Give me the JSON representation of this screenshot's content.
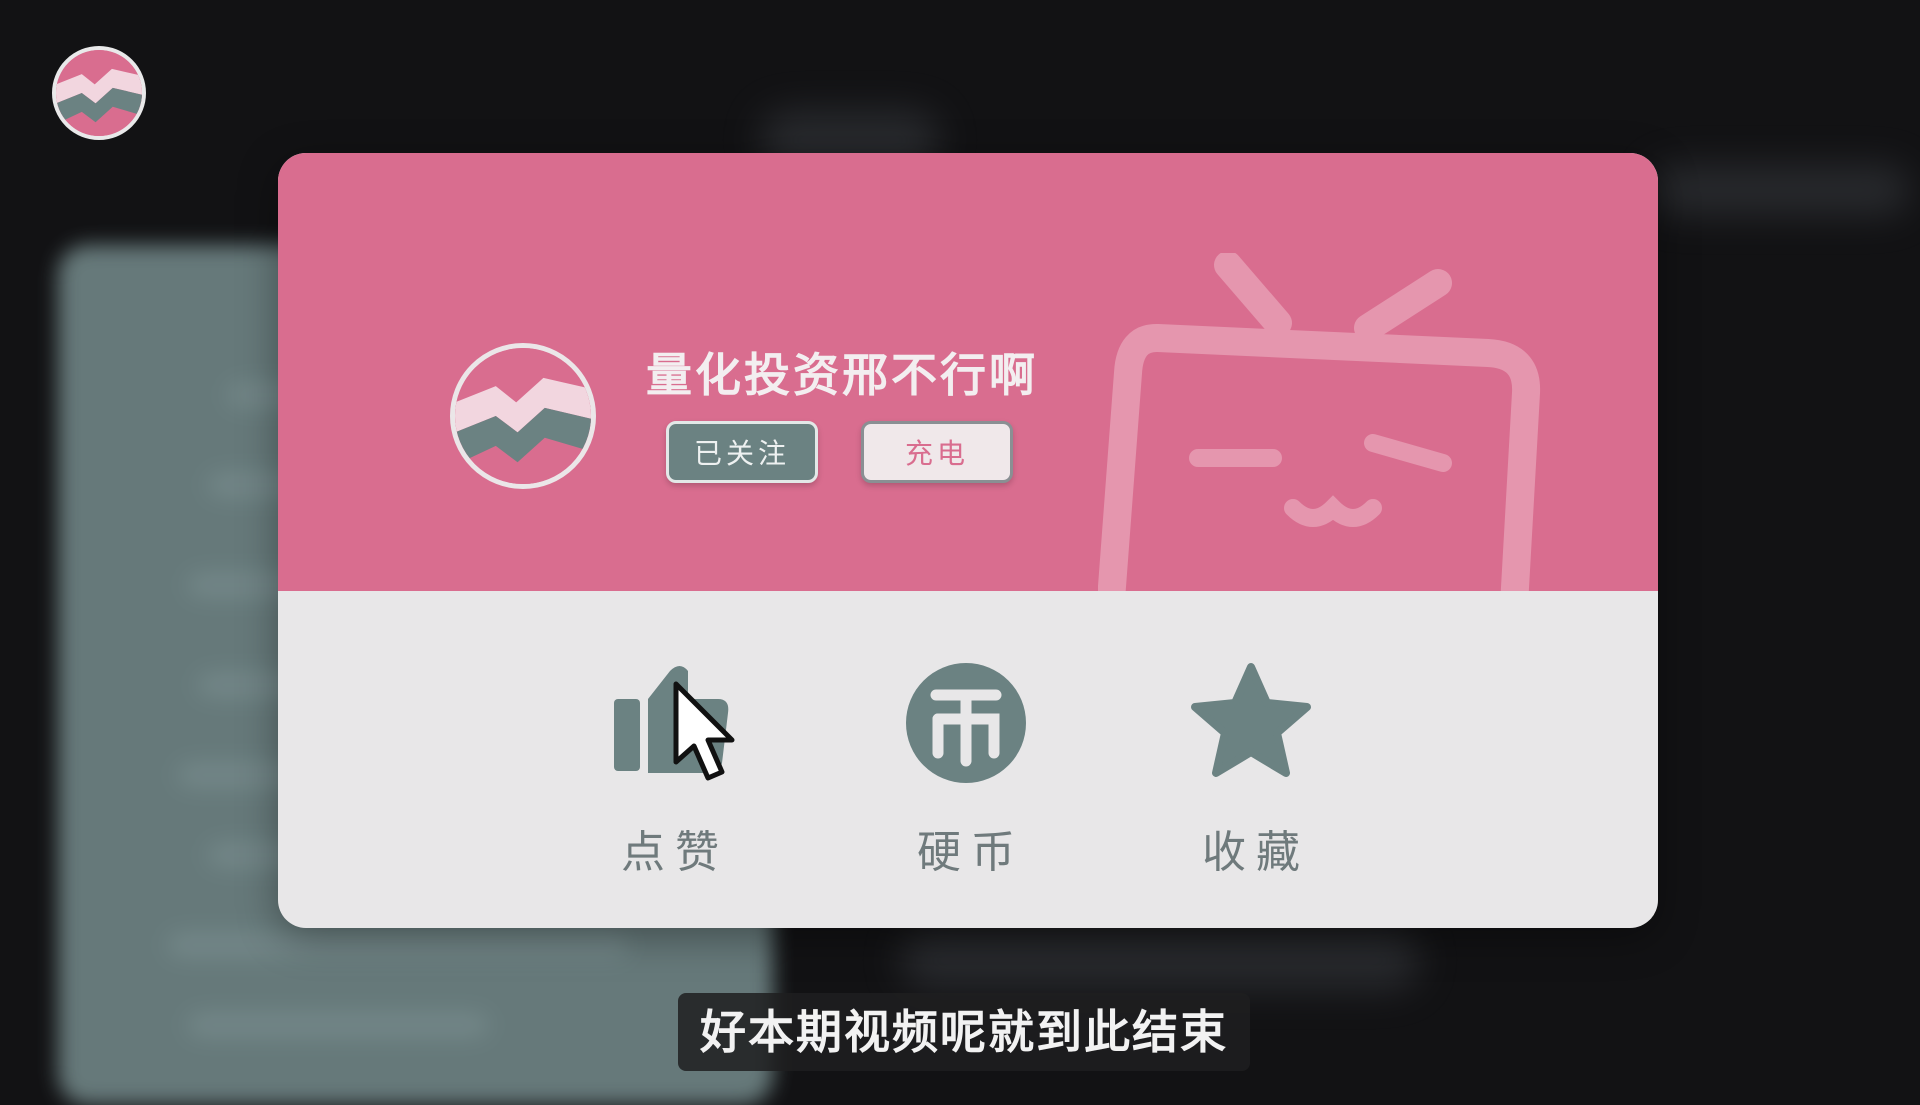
{
  "uploader": {
    "name": "量化投资邢不行啊",
    "follow_label": "已关注",
    "charge_label": "充电"
  },
  "actions": [
    {
      "label": "点赞",
      "icon": "thumbs-up-icon"
    },
    {
      "label": "硬币",
      "icon": "coin-icon"
    },
    {
      "label": "收藏",
      "icon": "star-icon"
    }
  ],
  "subtitle": "好本期视频呢就到此结束",
  "colors": {
    "brand_pink": "#d96d8f",
    "action_gray": "#6b8282",
    "card_light": "#e8e7e8",
    "background": "#121214"
  }
}
